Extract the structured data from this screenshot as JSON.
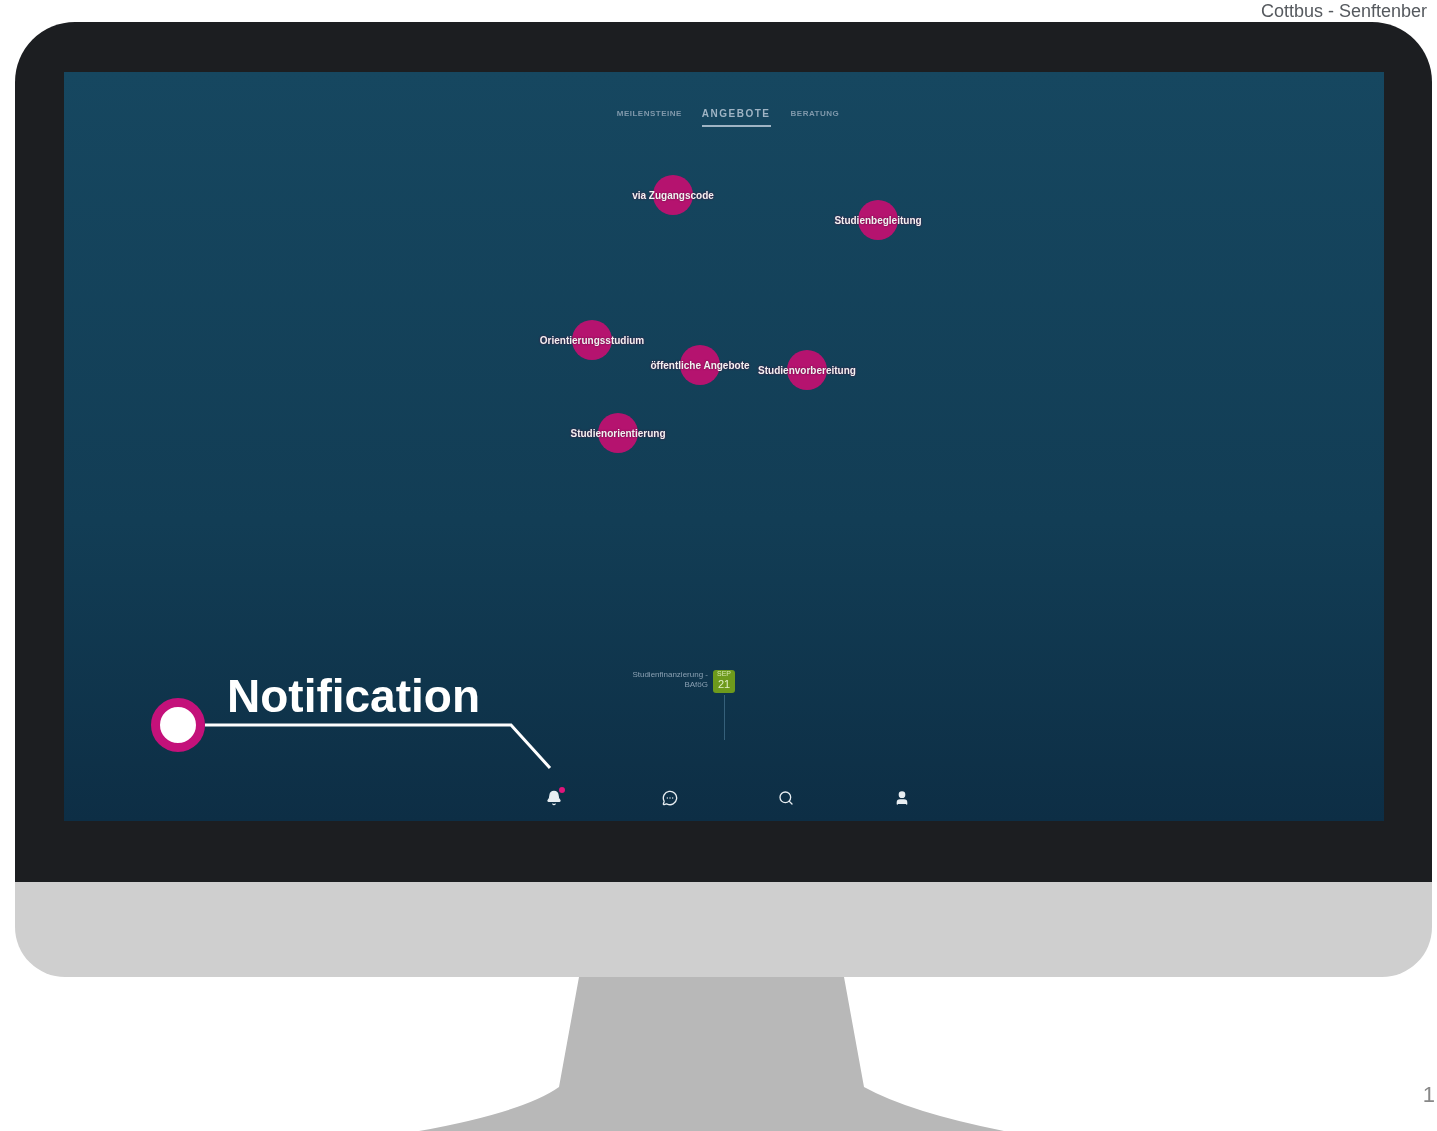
{
  "header": {
    "text": "Cottbus - Senftenber"
  },
  "screen": {
    "tabs": [
      {
        "label": "MEILENSTEINE",
        "selected": false
      },
      {
        "label": "ANGEBOTE",
        "selected": true
      },
      {
        "label": "BERATUNG",
        "selected": false
      }
    ],
    "nodes": [
      {
        "label": "via Zugangscode"
      },
      {
        "label": "Studienbegleitung"
      },
      {
        "label": "Orientierungsstudium"
      },
      {
        "label": "öffentliche Angebote"
      },
      {
        "label": "Studienvorbereitung"
      },
      {
        "label": "Studienorientierung"
      }
    ],
    "event": {
      "label_lines": [
        "Studienfinanzierung -",
        "BAföG"
      ],
      "month": "SEP",
      "day": "21"
    },
    "nav": [
      {
        "kind": "bell",
        "badge": true
      },
      {
        "kind": "chat",
        "badge": false
      },
      {
        "kind": "search",
        "badge": false
      },
      {
        "kind": "user",
        "badge": false
      }
    ]
  },
  "callout": {
    "label": "Notification"
  },
  "page_number": "1"
}
